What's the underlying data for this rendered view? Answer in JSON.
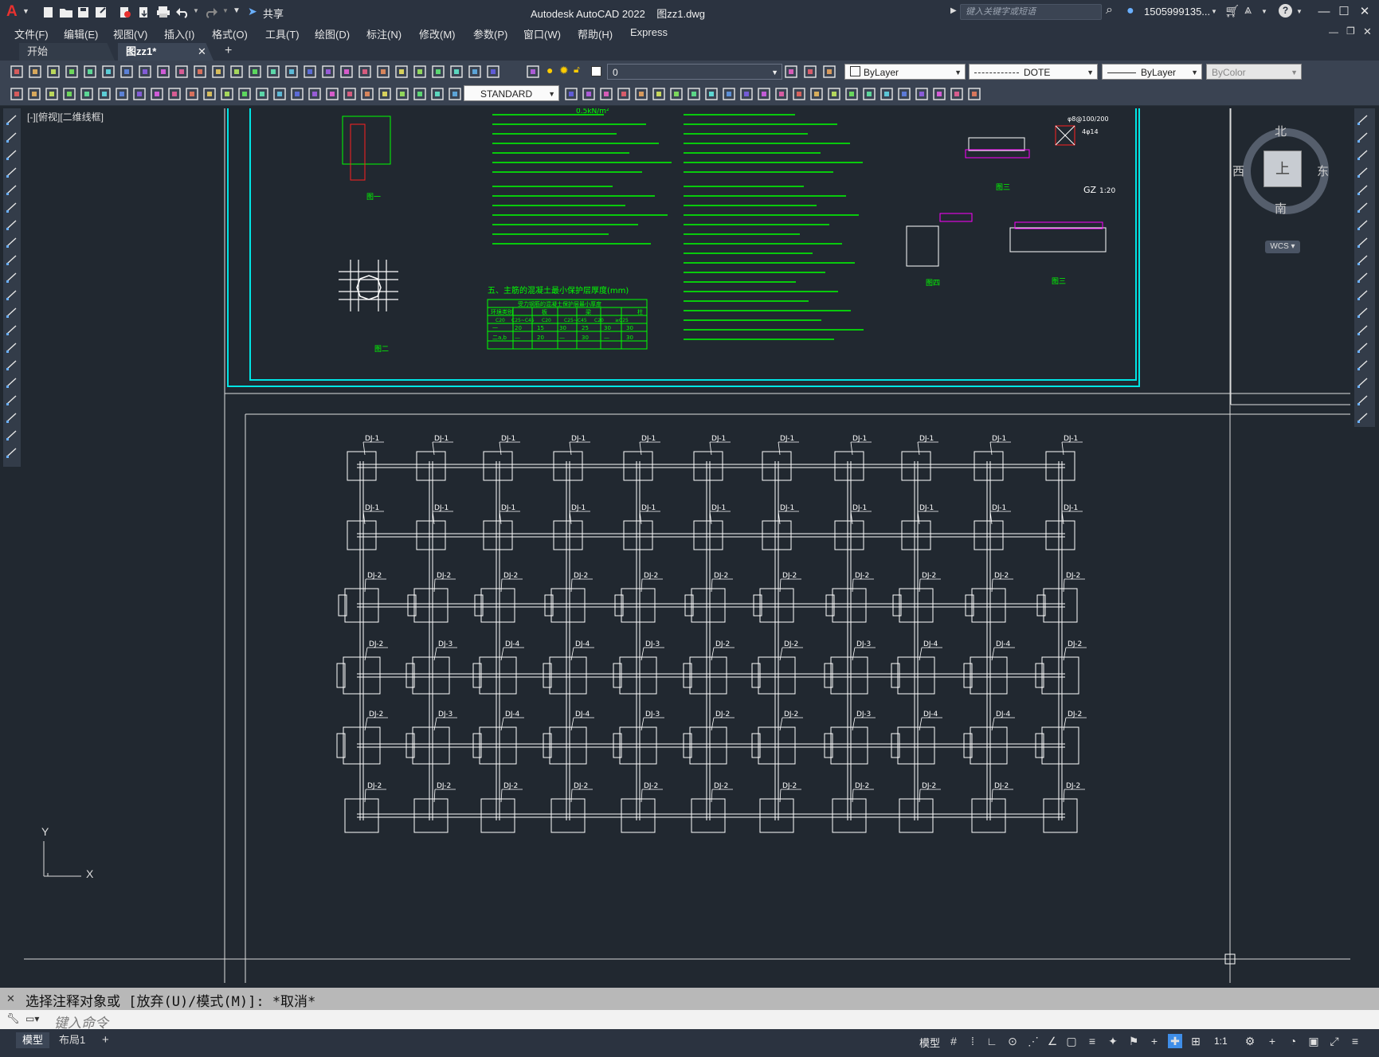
{
  "title_bar": {
    "app_title": "Autodesk AutoCAD 2022",
    "file_name": "图zz1.dwg",
    "share_label": "共享",
    "search_placeholder": "键入关键字或短语",
    "user_name": "1505999135...",
    "app_logo": "A"
  },
  "menu": {
    "items": [
      "文件(F)",
      "编辑(E)",
      "视图(V)",
      "插入(I)",
      "格式(O)",
      "工具(T)",
      "绘图(D)",
      "标注(N)",
      "修改(M)",
      "参数(P)",
      "窗口(W)",
      "帮助(H)",
      "Express"
    ]
  },
  "tabs": {
    "start": "开始",
    "active": "图zz1*",
    "close": "✕",
    "add": "+"
  },
  "properties": {
    "layer": "0",
    "color": "ByLayer",
    "linetype": "DOTE",
    "lineweight": "ByLayer",
    "plotstyle": "ByColor",
    "textstyle": "STANDARD"
  },
  "viewport": {
    "label": "[-][俯视][二维线框]"
  },
  "viewcube": {
    "north": "北",
    "south": "南",
    "east": "东",
    "west": "西",
    "top_face": "上",
    "wcs": "WCS"
  },
  "ucs": {
    "x": "X",
    "y": "Y"
  },
  "drawing": {
    "notes_small": "0.5kN/m²",
    "gz_label": "GZ",
    "gz_scale": "1:20",
    "gz_spec": "φ8@100/200",
    "gz_bar": "4φ14",
    "table_title": "五、主筋的混凝土最小保护层厚度(mm)",
    "table_sub": "受力钢筋的混凝土保护层最小厚度",
    "table_head": [
      "环境类别",
      "板",
      "梁",
      "柱"
    ],
    "table_row1": [
      "C20",
      "C25~C45",
      "C20",
      "C25~C45",
      "C20",
      "≥C25"
    ],
    "table_row2": [
      "一",
      "20",
      "15",
      "30",
      "25",
      "30",
      "30"
    ],
    "table_row3": [
      "二a,b",
      "—",
      "20",
      "—",
      "30",
      "—",
      "30"
    ],
    "fig1": "图一",
    "fig2": "图二",
    "fig3": "图三",
    "fig4": "图四",
    "footing_labels_row1": [
      "DJ-1"
    ],
    "footing_labels_row2": [
      "DJ-1"
    ],
    "footing_labels_row3": [
      "DJ-2"
    ],
    "footing_labels_row4": [
      "DJ-2",
      "DJ-3",
      "DJ-4"
    ],
    "footing_labels_row5": [
      "DJ-2",
      "DJ-3",
      "DJ-4"
    ],
    "footing_labels_row6": [
      "DJ-2"
    ]
  },
  "command": {
    "history": "选择注释对象或 [放弃(U)/模式(M)]: *取消*",
    "placeholder": "键入命令"
  },
  "status": {
    "model_tab": "模型",
    "layout_tab": "布局1",
    "add_tab": "+",
    "model_button": "模型",
    "scale": "1:1"
  },
  "colors": {
    "accent_green": "#00ff00",
    "cyan_frame": "#00e5e5",
    "magenta": "#ff00ff",
    "red": "#ff2020",
    "white_lines": "#ffffff"
  }
}
